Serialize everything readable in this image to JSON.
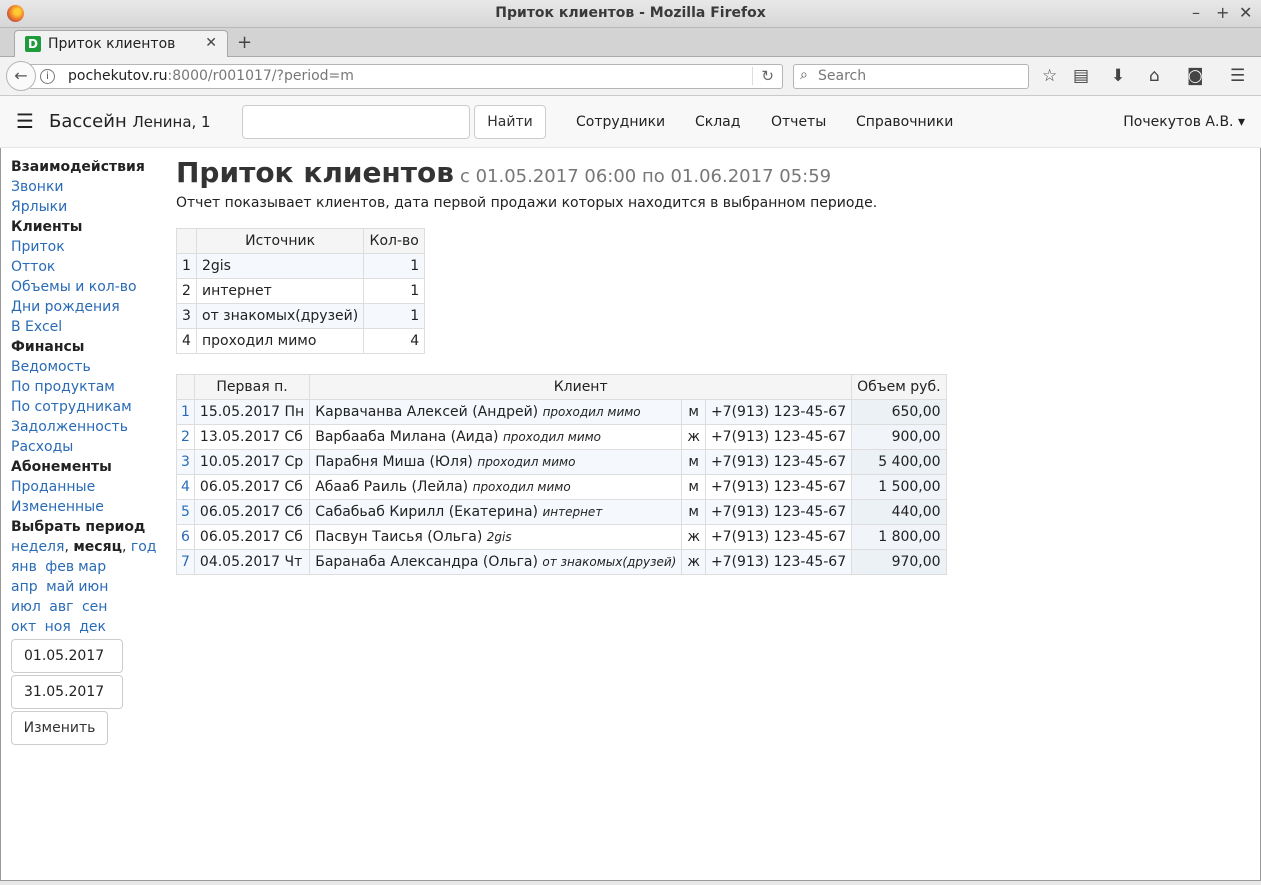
{
  "window": {
    "title": "Приток клиентов - Mozilla Firefox",
    "controls": [
      "–",
      "+",
      "✕"
    ]
  },
  "tab": {
    "favicon_letter": "D",
    "title": "Приток клиентов",
    "close": "✕",
    "new_tab": "+"
  },
  "nav": {
    "url_host": "pochekutov.ru",
    "url_rest": ":8000/r001017/?period=m",
    "search_placeholder": "Search"
  },
  "header": {
    "brand": "Бассейн",
    "brand_sub": "Ленина, 1",
    "search_value": "",
    "find_label": "Найти",
    "menu": [
      "Сотрудники",
      "Склад",
      "Отчеты",
      "Справочники"
    ],
    "user": "Почекутов А.В."
  },
  "sidebar": {
    "sections": [
      {
        "title": "Взаимодействия",
        "links": [
          "Звонки",
          "Ярлыки"
        ]
      },
      {
        "title": "Клиенты",
        "links": [
          "Приток",
          "Отток",
          "Объемы и кол-во",
          "Дни рождения",
          "В Excel"
        ]
      },
      {
        "title": "Финансы",
        "links": [
          "Ведомость",
          "По продуктам",
          "По сотрудникам",
          "Задолженность",
          "Расходы"
        ]
      },
      {
        "title": "Абонементы",
        "links": [
          "Проданные",
          "Измененные"
        ]
      }
    ],
    "period": {
      "title": "Выбрать период",
      "week": "неделя",
      "comma": ",",
      "month": "месяц",
      "year": "год",
      "months": [
        [
          "янв",
          "фев",
          "мар"
        ],
        [
          "апр",
          "май",
          "июн"
        ],
        [
          "июл",
          "авг",
          "сен"
        ],
        [
          "окт",
          "ноя",
          "дек"
        ]
      ],
      "date_from": "01.05.2017",
      "date_to": "31.05.2017",
      "apply": "Изменить"
    }
  },
  "main": {
    "title": "Приток клиентов",
    "period": "с 01.05.2017 06:00 по 01.06.2017 05:59",
    "description": "Отчет показывает клиентов, дата первой продажи которых находится в выбранном периоде.",
    "sources": {
      "headers": [
        "",
        "Источник",
        "Кол-во"
      ],
      "rows": [
        [
          "1",
          "2gis",
          "1"
        ],
        [
          "2",
          "интернет",
          "1"
        ],
        [
          "3",
          "от знакомых(друзей)",
          "1"
        ],
        [
          "4",
          "проходил мимо",
          "4"
        ]
      ]
    },
    "clients": {
      "headers": [
        "",
        "Первая п.",
        "Клиент",
        "Объем руб."
      ],
      "rows": [
        {
          "n": "1",
          "date": "15.05.2017 Пн",
          "name": "Карвачанва Алексей (Андрей)",
          "source": "проходил мимо",
          "sex": "м",
          "phone": "+7(913) 123-45-67",
          "amount": "650,00"
        },
        {
          "n": "2",
          "date": "13.05.2017 Сб",
          "name": "Варбааба Милана (Аида)",
          "source": "проходил мимо",
          "sex": "ж",
          "phone": "+7(913) 123-45-67",
          "amount": "900,00"
        },
        {
          "n": "3",
          "date": "10.05.2017 Ср",
          "name": "Парабня Миша (Юля)",
          "source": "проходил мимо",
          "sex": "м",
          "phone": "+7(913) 123-45-67",
          "amount": "5 400,00"
        },
        {
          "n": "4",
          "date": "06.05.2017 Сб",
          "name": "Абааб Раиль (Лейла)",
          "source": "проходил мимо",
          "sex": "м",
          "phone": "+7(913) 123-45-67",
          "amount": "1 500,00"
        },
        {
          "n": "5",
          "date": "06.05.2017 Сб",
          "name": "Сабабьаб Кирилл (Екатерина)",
          "source": "интернет",
          "sex": "м",
          "phone": "+7(913) 123-45-67",
          "amount": "440,00"
        },
        {
          "n": "6",
          "date": "06.05.2017 Сб",
          "name": "Пасвун Таисья (Ольга)",
          "source": "2gis",
          "sex": "ж",
          "phone": "+7(913) 123-45-67",
          "amount": "1 800,00"
        },
        {
          "n": "7",
          "date": "04.05.2017 Чт",
          "name": "Баранаба Александра (Ольга)",
          "source": "от знакомых(друзей)",
          "sex": "ж",
          "phone": "+7(913) 123-45-67",
          "amount": "970,00"
        }
      ]
    }
  }
}
